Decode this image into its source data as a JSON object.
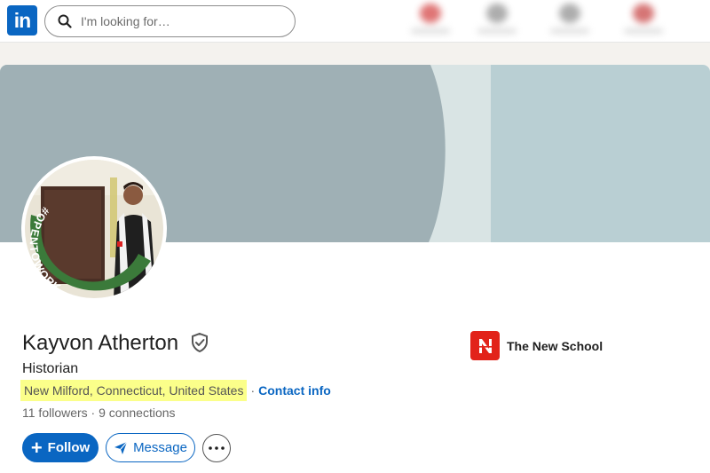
{
  "nav": {
    "logo_text": "in",
    "search_placeholder": "I'm looking for…",
    "blurred_items": [
      {
        "icon": "notifications-icon",
        "color": "#d23a3a"
      },
      {
        "icon": "jobs-icon",
        "color": "#8a8a8a"
      },
      {
        "icon": "messaging-icon",
        "color": "#8a8a8a"
      },
      {
        "icon": "alerts-icon",
        "color": "#c43a3a"
      }
    ]
  },
  "profile": {
    "name": "Kayvon Atherton",
    "headline": "Historian",
    "location": "New Milford, Connecticut, United States",
    "separator": "·",
    "contact_info_label": "Contact info",
    "followers": "11 followers",
    "connections_separator": " · ",
    "connections": "9 connections",
    "open_to_work_badge": "#OPENTOWORK",
    "education": {
      "school": "The New School",
      "logo_letter": "N"
    }
  },
  "actions": {
    "follow_label": "Follow",
    "message_label": "Message"
  },
  "colors": {
    "brand": "#0a66c2",
    "highlight": "#fbff8a",
    "open_to_work_green": "#3b7a3a",
    "school_red": "#e2231a",
    "banner_gray": "#9fb0b5",
    "banner_light": "#bcd3d6"
  }
}
